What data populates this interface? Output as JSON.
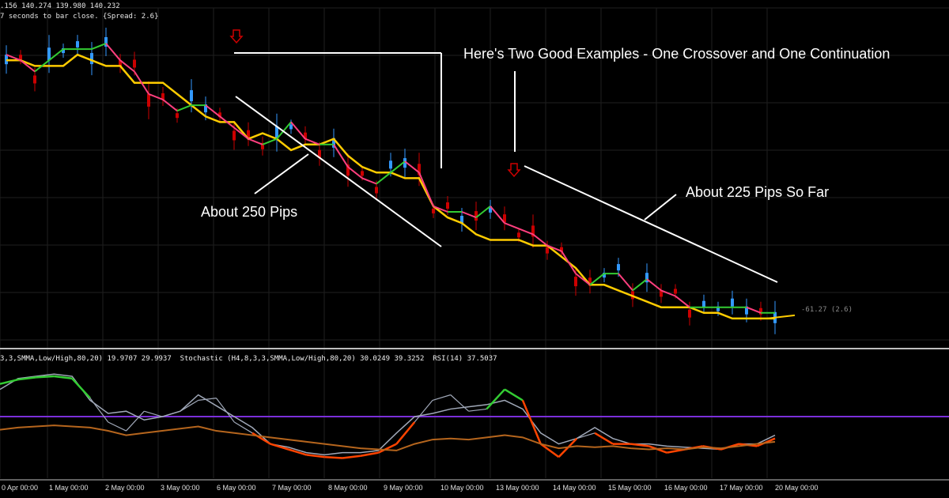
{
  "header": {
    "ohlc_line": ".156 140.274 139.980 140.232",
    "timer_line": "7 seconds to bar close. {Spread: 2.6}"
  },
  "annotations": {
    "examples": "Here's Two Good Examples - One Crossover and One Continuation",
    "pips_250": "About 250 Pips",
    "pips_225": "About 225 Pips So Far"
  },
  "price_label": "-61.27 (2.6)",
  "indicator_header": "3,3,SMMA,Low/High,80,20) 19.9707 29.9937  Stochastic (H4,8,3,3,SMMA,Low/High,80,20) 30.0249 39.3252  RSI(14) 37.5037",
  "x_axis": {
    "ticks": [
      "0 Apr 00:00",
      "1 May 00:00",
      "2 May 00:00",
      "3 May 00:00",
      "6 May 00:00",
      "7 May 00:00",
      "8 May 00:00",
      "9 May 00:00",
      "10 May 00:00",
      "13 May 00:00",
      "14 May 00:00",
      "15 May 00:00",
      "16 May 00:00",
      "17 May 00:00",
      "20 May 00:00"
    ]
  },
  "colors": {
    "background": "#000000",
    "grid": "#1f1f1f",
    "bear_candle": "#cc0000",
    "bull_candle": "#3399ff",
    "fast_ma": "#ff3f7f",
    "fast_ma_up": "#33cc33",
    "slow_ma": "#ffcc00",
    "rsi": "#b5651d",
    "level_line": "#7b2fd9",
    "stochastic_main": "#ff2200",
    "stochastic_signal": "#a0a8b8"
  },
  "chart_data": [
    {
      "type": "candlestick",
      "title": "",
      "series": [
        {
          "values": [
            147,
            147,
            146,
            146,
            146,
            148,
            147,
            146,
            146,
            143,
            143,
            143,
            141,
            139,
            137,
            136,
            136,
            133,
            134,
            133,
            131,
            132,
            132,
            133,
            130,
            128,
            127,
            127,
            126,
            126,
            121,
            119,
            118,
            116,
            115,
            115,
            115,
            114,
            114,
            112,
            110,
            107,
            107,
            106,
            105,
            104,
            103,
            103,
            103,
            102,
            102,
            101,
            101,
            101,
            101
          ]
        },
        {
          "values": [
            148,
            147,
            145,
            147,
            149,
            149,
            149,
            150,
            147,
            145,
            141,
            140,
            138,
            139,
            139,
            137,
            135,
            133,
            132,
            133,
            136,
            133,
            132,
            132,
            128,
            126,
            125,
            127,
            129,
            127,
            121,
            120,
            120,
            119,
            121,
            118,
            117,
            116,
            114,
            113,
            109,
            107,
            109,
            109,
            106,
            108,
            106,
            105,
            103,
            103,
            103,
            103,
            103,
            102,
            102
          ]
        }
      ]
    },
    {
      "type": "line",
      "title": "",
      "series": [
        {
          "values": [
            85,
            89,
            91,
            92,
            90,
            72,
            50,
            42,
            60,
            55,
            60,
            70,
            72,
            50,
            40,
            30,
            25,
            20,
            18,
            17,
            19,
            22,
            30,
            50,
            70,
            75,
            60,
            62,
            80,
            70,
            30,
            18,
            35,
            40,
            30,
            30,
            28,
            22,
            25,
            28,
            25,
            30,
            28,
            35
          ]
        },
        {
          "values": [
            80,
            90,
            92,
            94,
            92,
            70,
            58,
            60,
            52,
            55,
            60,
            75,
            65,
            55,
            45,
            30,
            27,
            22,
            20,
            22,
            22,
            24,
            40,
            55,
            58,
            62,
            64,
            66,
            70,
            62,
            40,
            30,
            35,
            45,
            35,
            30,
            30,
            28,
            27,
            26,
            25,
            30,
            30,
            38
          ]
        },
        {
          "values": [
            43,
            45,
            46,
            47,
            46,
            45,
            42,
            38,
            40,
            42,
            44,
            46,
            42,
            40,
            38,
            36,
            34,
            32,
            30,
            28,
            26,
            25,
            24,
            30,
            34,
            35,
            34,
            36,
            38,
            36,
            30,
            26,
            28,
            27,
            28,
            26,
            25,
            26,
            25,
            27,
            26,
            28,
            30,
            32
          ]
        }
      ],
      "levels": [
        20,
        80
      ]
    }
  ]
}
